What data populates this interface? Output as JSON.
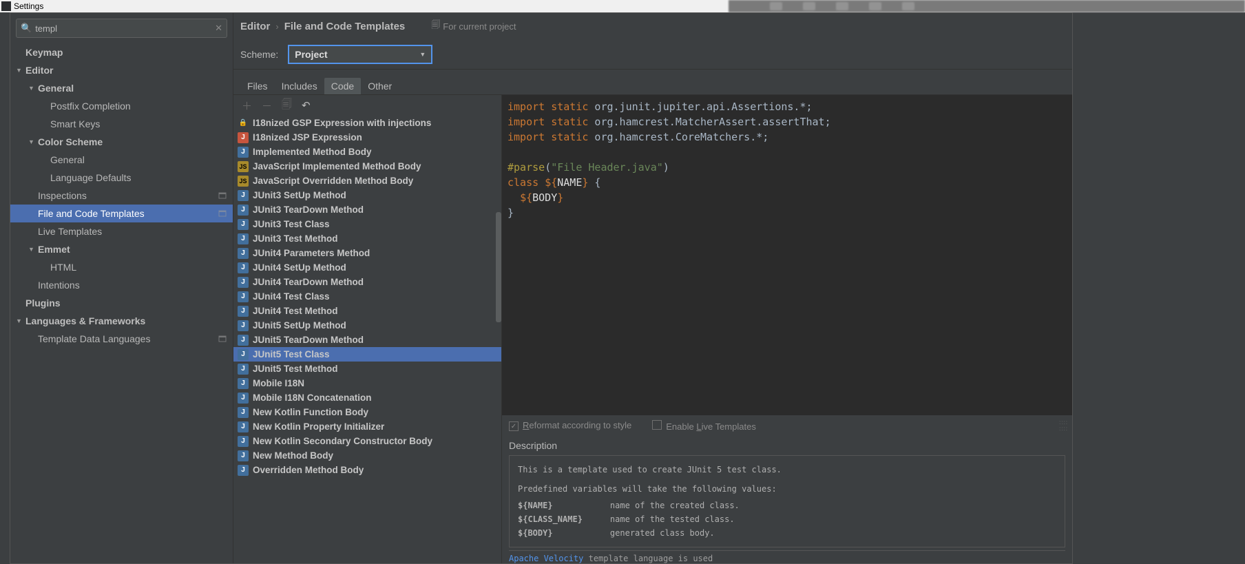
{
  "window": {
    "title": "Settings"
  },
  "search": {
    "value": "templ"
  },
  "tree": [
    {
      "label": "Keymap",
      "indent": 0,
      "bold": true
    },
    {
      "label": "Editor",
      "indent": 0,
      "bold": true,
      "arrow": "▼"
    },
    {
      "label": "General",
      "indent": 1,
      "bold": true,
      "arrow": "▼"
    },
    {
      "label": "Postfix Completion",
      "indent": 2
    },
    {
      "label": "Smart Keys",
      "indent": 2
    },
    {
      "label": "Color Scheme",
      "indent": 1,
      "bold": true,
      "arrow": "▼"
    },
    {
      "label": "General",
      "indent": 2
    },
    {
      "label": "Language Defaults",
      "indent": 2
    },
    {
      "label": "Inspections",
      "indent": 1,
      "badge": true
    },
    {
      "label": "File and Code Templates",
      "indent": 1,
      "badge": true,
      "selected": true
    },
    {
      "label": "Live Templates",
      "indent": 1
    },
    {
      "label": "Emmet",
      "indent": 1,
      "bold": true,
      "arrow": "▼"
    },
    {
      "label": "HTML",
      "indent": 2
    },
    {
      "label": "Intentions",
      "indent": 1
    },
    {
      "label": "Plugins",
      "indent": 0,
      "bold": true
    },
    {
      "label": "Languages & Frameworks",
      "indent": 0,
      "bold": true,
      "arrow": "▼"
    },
    {
      "label": "Template Data Languages",
      "indent": 1,
      "badge": true
    }
  ],
  "breadcrumb": {
    "parent": "Editor",
    "current": "File and Code Templates",
    "scope": "For current project"
  },
  "scheme": {
    "label": "Scheme:",
    "value": "Project"
  },
  "tabs": [
    "Files",
    "Includes",
    "Code",
    "Other"
  ],
  "active_tab": 2,
  "templates": [
    {
      "label": "I18nized GSP Expression with injections",
      "icon": "lock"
    },
    {
      "label": "I18nized JSP Expression",
      "icon": "jsp"
    },
    {
      "label": "Implemented Method Body",
      "icon": "java"
    },
    {
      "label": "JavaScript Implemented Method Body",
      "icon": "js"
    },
    {
      "label": "JavaScript Overridden Method Body",
      "icon": "js"
    },
    {
      "label": "JUnit3 SetUp Method",
      "icon": "java"
    },
    {
      "label": "JUnit3 TearDown Method",
      "icon": "java"
    },
    {
      "label": "JUnit3 Test Class",
      "icon": "java"
    },
    {
      "label": "JUnit3 Test Method",
      "icon": "java"
    },
    {
      "label": "JUnit4 Parameters Method",
      "icon": "java"
    },
    {
      "label": "JUnit4 SetUp Method",
      "icon": "java"
    },
    {
      "label": "JUnit4 TearDown Method",
      "icon": "java"
    },
    {
      "label": "JUnit4 Test Class",
      "icon": "java"
    },
    {
      "label": "JUnit4 Test Method",
      "icon": "java"
    },
    {
      "label": "JUnit5 SetUp Method",
      "icon": "java"
    },
    {
      "label": "JUnit5 TearDown Method",
      "icon": "java"
    },
    {
      "label": "JUnit5 Test Class",
      "icon": "java",
      "selected": true
    },
    {
      "label": "JUnit5 Test Method",
      "icon": "java"
    },
    {
      "label": "Mobile I18N",
      "icon": "java"
    },
    {
      "label": "Mobile I18N Concatenation",
      "icon": "java"
    },
    {
      "label": "New Kotlin Function Body",
      "icon": "java"
    },
    {
      "label": "New Kotlin Property Initializer",
      "icon": "java"
    },
    {
      "label": "New Kotlin Secondary Constructor Body",
      "icon": "java"
    },
    {
      "label": "New Method Body",
      "icon": "java"
    },
    {
      "label": "Overridden Method Body",
      "icon": "java"
    }
  ],
  "code": {
    "l1a": "import static",
    "l1b": " org.junit.jupiter.api.Assertions.*;",
    "l2a": "import static",
    "l2b": " org.hamcrest.MatcherAssert.assertThat;",
    "l3a": "import static",
    "l3b": " org.hamcrest.CoreMatchers.*;",
    "l5a": "#parse",
    "l5b": "(",
    "l5c": "\"File Header.java\"",
    "l5d": ")",
    "l6a": "class ",
    "l6b": "${",
    "l6c": "NAME",
    "l6d": "}",
    "l6e": " {",
    "l7a": "  ",
    "l7b": "${",
    "l7c": "BODY",
    "l7d": "}",
    "l8": "}"
  },
  "checks": {
    "reformat": "Reformat according to style",
    "live": "Enable Live Templates",
    "reformat_u": "R",
    "live_u": "L"
  },
  "description": {
    "label": "Description",
    "intro": "This is a template used to create JUnit 5 test class.",
    "predef": "Predefined variables will take the following values:",
    "vars": [
      {
        "k": "${NAME}",
        "v": "name of the created class."
      },
      {
        "k": "${CLASS_NAME}",
        "v": "name of the tested class."
      },
      {
        "k": "${BODY}",
        "v": "generated class body."
      }
    ]
  },
  "langnote": {
    "link": "Apache Velocity",
    "rest": " template language is used"
  }
}
